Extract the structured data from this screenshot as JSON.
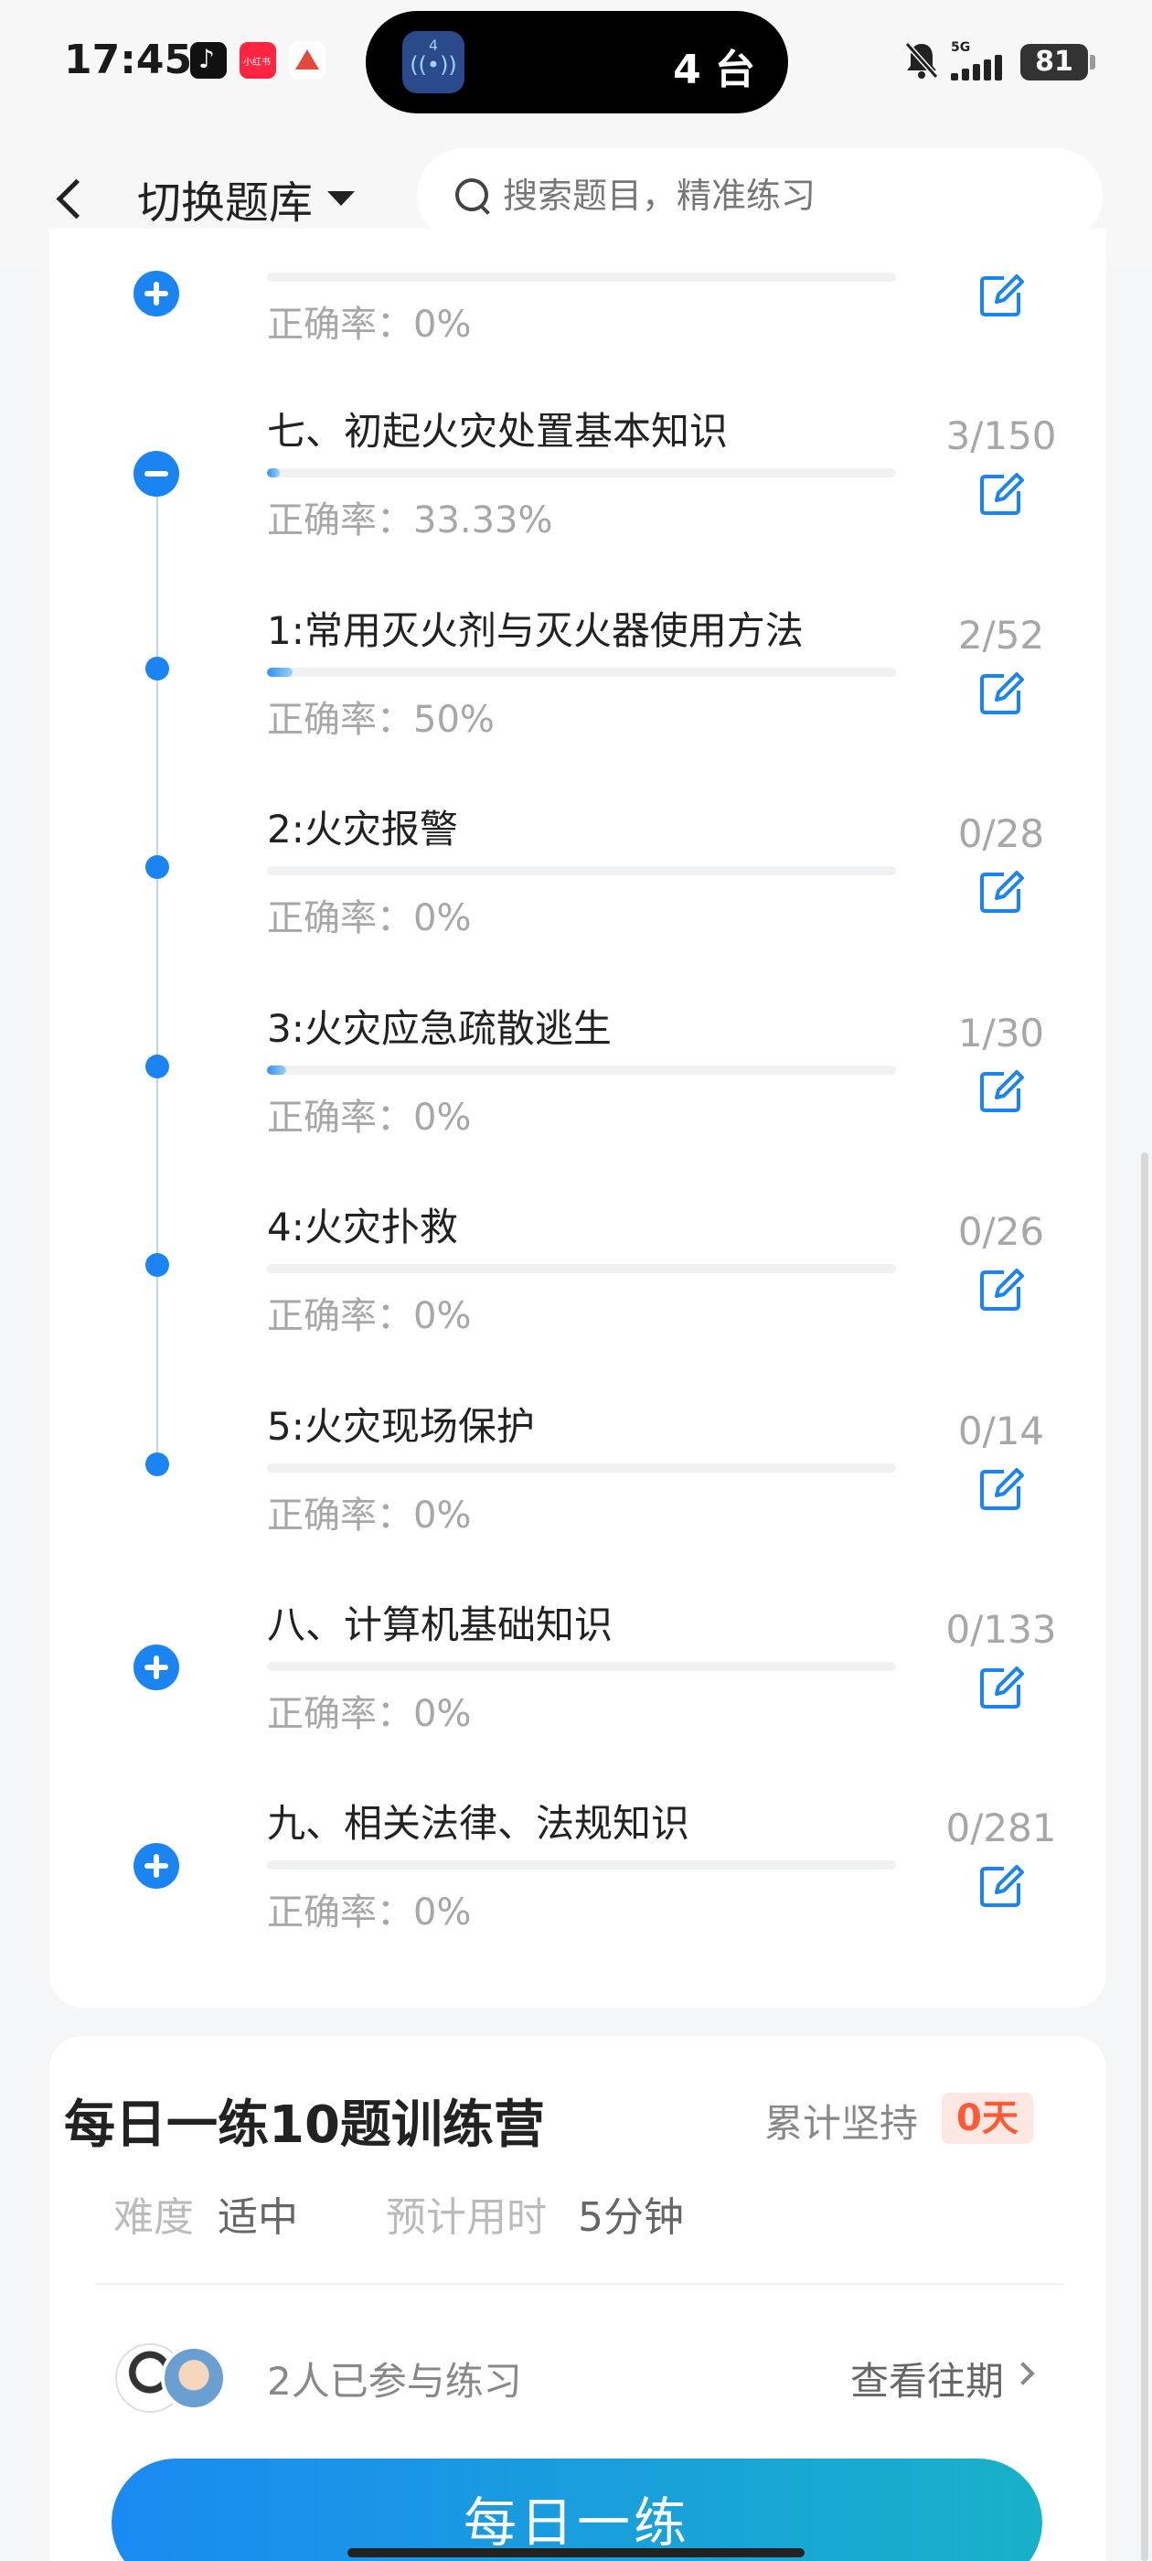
{
  "status_bar": {
    "time": "17:45",
    "island_number": "4",
    "island_text": "4 台",
    "signal_label": "5G",
    "battery": "81",
    "icons": [
      "tiktok-icon",
      "xiaohongshu-icon",
      "app-icon",
      "bell-off-icon",
      "signal-icon",
      "battery-icon"
    ]
  },
  "header": {
    "switch_label": "切换题库",
    "search_placeholder": "搜索题目，精准练习"
  },
  "chapters": [
    {
      "title": "",
      "accuracy": "正确率：0%",
      "count": "",
      "progress": 0,
      "type": "plus"
    },
    {
      "title": "七、初起火灾处置基本知识",
      "accuracy": "正确率：33.33%",
      "count": "3/150",
      "progress": 0.02,
      "type": "minus"
    },
    {
      "title": "1:常用灭火剂与灭火器使用方法",
      "accuracy": "正确率：50%",
      "count": "2/52",
      "progress": 0.04,
      "type": "dot"
    },
    {
      "title": "2:火灾报警",
      "accuracy": "正确率：0%",
      "count": "0/28",
      "progress": 0,
      "type": "dot"
    },
    {
      "title": "3:火灾应急疏散逃生",
      "accuracy": "正确率：0%",
      "count": "1/30",
      "progress": 0.03,
      "type": "dot"
    },
    {
      "title": "4:火灾扑救",
      "accuracy": "正确率：0%",
      "count": "0/26",
      "progress": 0,
      "type": "dot"
    },
    {
      "title": "5:火灾现场保护",
      "accuracy": "正确率：0%",
      "count": "0/14",
      "progress": 0,
      "type": "dot"
    },
    {
      "title": "八、计算机基础知识",
      "accuracy": "正确率：0%",
      "count": "0/133",
      "progress": 0,
      "type": "plus"
    },
    {
      "title": "九、相关法律、法规知识",
      "accuracy": "正确率：0%",
      "count": "0/281",
      "progress": 0,
      "type": "plus"
    }
  ],
  "daily": {
    "title": "每日一练10题训练营",
    "streak_label": "累计坚持",
    "streak_value": "0天",
    "difficulty_label": "难度",
    "difficulty_value": "适中",
    "time_label": "预计用时",
    "time_value": "5分钟",
    "participants": "2人已参与练习",
    "history_link": "查看往期",
    "button": "每日一练"
  },
  "colors": {
    "accent": "#1a84f2",
    "streak": "#ff5a34",
    "button_gradient_start": "#1a8af2",
    "button_gradient_end": "#18b1c8"
  }
}
